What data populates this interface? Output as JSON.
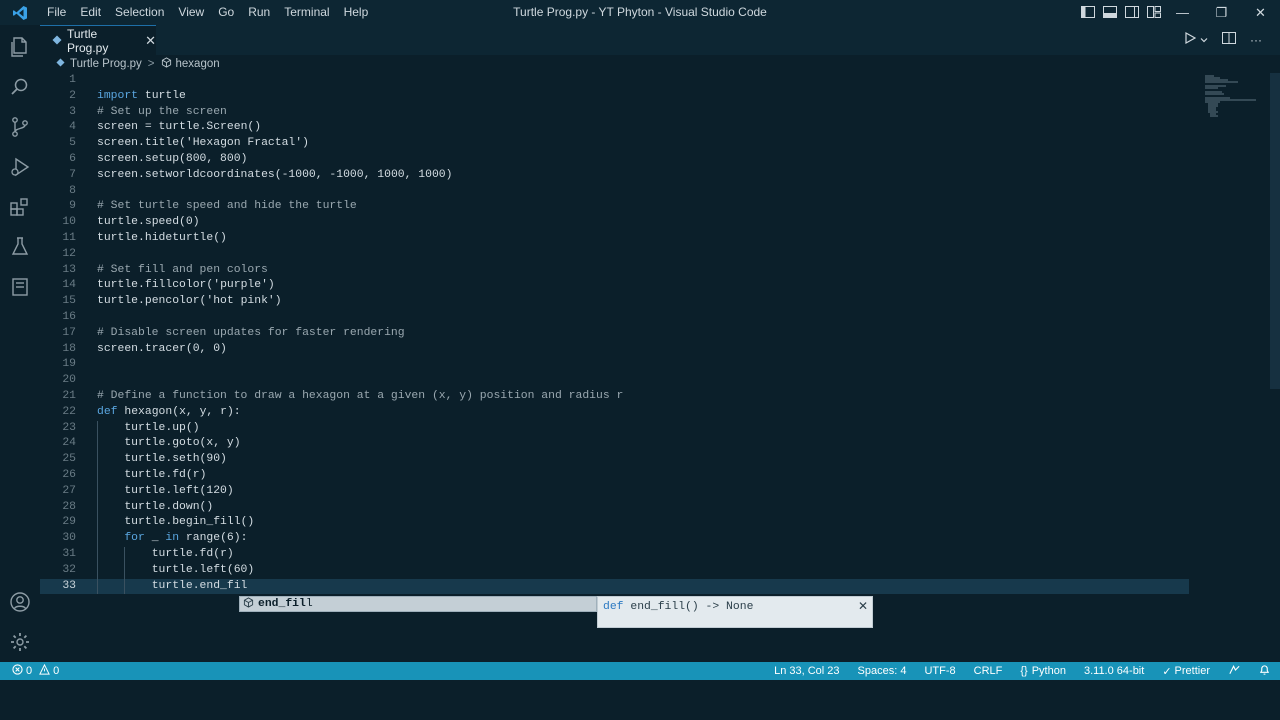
{
  "titlebar": {
    "menu": [
      "File",
      "Edit",
      "Selection",
      "View",
      "Go",
      "Run",
      "Terminal",
      "Help"
    ],
    "window_title": "Turtle Prog.py - YT Phyton - Visual Studio Code",
    "controls": {
      "minimize": "—",
      "maximize": "❐",
      "close": "✕"
    }
  },
  "tab": {
    "label": "Turtle Prog.py",
    "close": "✕"
  },
  "breadcrumb": {
    "file": "Turtle Prog.py",
    "symbol": "hexagon",
    "separator": ">"
  },
  "editor": {
    "lines": [
      {
        "num": "1",
        "code": ""
      },
      {
        "num": "2",
        "code": "import turtle"
      },
      {
        "num": "3",
        "code": "# Set up the screen"
      },
      {
        "num": "4",
        "code": "screen = turtle.Screen()"
      },
      {
        "num": "5",
        "code": "screen.title('Hexagon Fractal')"
      },
      {
        "num": "6",
        "code": "screen.setup(800, 800)"
      },
      {
        "num": "7",
        "code": "screen.setworldcoordinates(-1000, -1000, 1000, 1000)"
      },
      {
        "num": "8",
        "code": ""
      },
      {
        "num": "9",
        "code": "# Set turtle speed and hide the turtle"
      },
      {
        "num": "10",
        "code": "turtle.speed(0)"
      },
      {
        "num": "11",
        "code": "turtle.hideturtle()"
      },
      {
        "num": "12",
        "code": ""
      },
      {
        "num": "13",
        "code": "# Set fill and pen colors"
      },
      {
        "num": "14",
        "code": "turtle.fillcolor('purple')"
      },
      {
        "num": "15",
        "code": "turtle.pencolor('hot pink')"
      },
      {
        "num": "16",
        "code": ""
      },
      {
        "num": "17",
        "code": "# Disable screen updates for faster rendering"
      },
      {
        "num": "18",
        "code": "screen.tracer(0, 0)"
      },
      {
        "num": "19",
        "code": ""
      },
      {
        "num": "20",
        "code": ""
      },
      {
        "num": "21",
        "code": "# Define a function to draw a hexagon at a given (x, y) position and radius r"
      },
      {
        "num": "22",
        "code": "def hexagon(x, y, r):"
      },
      {
        "num": "23",
        "code": "    turtle.up()"
      },
      {
        "num": "24",
        "code": "    turtle.goto(x, y)"
      },
      {
        "num": "25",
        "code": "    turtle.seth(90)"
      },
      {
        "num": "26",
        "code": "    turtle.fd(r)"
      },
      {
        "num": "27",
        "code": "    turtle.left(120)"
      },
      {
        "num": "28",
        "code": "    turtle.down()"
      },
      {
        "num": "29",
        "code": "    turtle.begin_fill()"
      },
      {
        "num": "30",
        "code": "    for _ in range(6):"
      },
      {
        "num": "31",
        "code": "        turtle.fd(r)"
      },
      {
        "num": "32",
        "code": "        turtle.left(60)"
      },
      {
        "num": "33",
        "code": "        turtle.end_fil"
      }
    ],
    "current_line": "33"
  },
  "autocomplete": {
    "suggestion_match": "end_fil",
    "suggestion_rest": "l",
    "detail_keyword": "def",
    "detail_signature": "end_fill() -> None",
    "close": "✕"
  },
  "status": {
    "errors": "0",
    "warnings": "0",
    "position": "Ln 33, Col 23",
    "spaces": "Spaces: 4",
    "encoding": "UTF-8",
    "eol": "CRLF",
    "language": "Python",
    "interpreter": "3.11.0 64-bit",
    "formatter": "Prettier"
  },
  "colors": {
    "accent": "#1893b8",
    "background": "#0b1f2a",
    "keyword": "#5aa6e0"
  }
}
